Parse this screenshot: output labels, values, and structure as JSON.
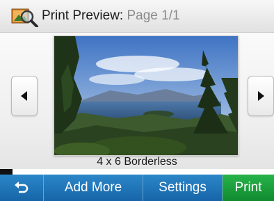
{
  "header": {
    "title": "Print Preview:",
    "page_indicator": "Page 1/1",
    "icon": "print-preview-icon"
  },
  "preview": {
    "caption": "4 x 6 Borderless",
    "photo_description_icon": "landscape-photo",
    "prev_icon": "triangle-left-icon",
    "next_icon": "triangle-right-icon"
  },
  "toolbar": {
    "back_icon": "back-arrow-icon",
    "add_more_label": "Add More",
    "settings_label": "Settings",
    "print_label": "Print"
  },
  "colors": {
    "toolbar_blue": "#1f78bd",
    "print_green": "#1ea23d",
    "title_text": "#1a1a1a",
    "page_text": "#8a8a8a"
  }
}
